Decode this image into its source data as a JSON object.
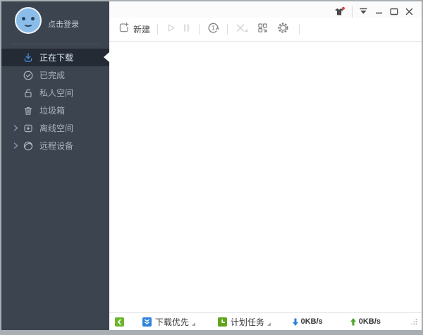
{
  "sidebar": {
    "login_label": "点击登录",
    "items": [
      {
        "label": "正在下载",
        "icon": "downloading-icon",
        "active": true,
        "expandable": false
      },
      {
        "label": "已完成",
        "icon": "check-circle-icon",
        "active": false,
        "expandable": false
      },
      {
        "label": "私人空间",
        "icon": "lock-icon",
        "active": false,
        "expandable": false
      },
      {
        "label": "垃圾箱",
        "icon": "trash-icon",
        "active": false,
        "expandable": false
      },
      {
        "label": "离线空间",
        "icon": "offline-space-icon",
        "active": false,
        "expandable": true
      },
      {
        "label": "远程设备",
        "icon": "remote-device-icon",
        "active": false,
        "expandable": true
      }
    ]
  },
  "titlebar": {
    "icons": [
      "skin-shirt-icon",
      "main-menu-icon",
      "minimize-icon",
      "maximize-icon",
      "close-icon"
    ],
    "skin_has_notification": true
  },
  "toolbar": {
    "new_label": "新建",
    "once_badge": "1",
    "icons": [
      "new-task-icon",
      "start-icon",
      "pause-icon",
      "once-speedup-icon",
      "delete-icon",
      "grid-panel-icon",
      "settings-gear-icon"
    ],
    "disabled_icons": [
      "start-icon",
      "pause-icon",
      "delete-icon"
    ]
  },
  "statusbar": {
    "collapse_icon": "collapse-left-icon",
    "download_priority_label": "下载优先",
    "scheduled_tasks_label": "计划任务",
    "download_speed": "0KB/s",
    "upload_speed": "0KB/s"
  },
  "colors": {
    "sidebar_bg": "#3c4450",
    "sidebar_active_bg": "#242b35",
    "accent_blue": "#4a97e8",
    "collapse_green": "#6cb52d",
    "priority_blue": "#2e83dd",
    "schedule_green": "#61a51f",
    "down_arrow_blue": "#2e7fd9",
    "up_arrow_green": "#4ea32a",
    "notification_red": "#e8403c"
  }
}
